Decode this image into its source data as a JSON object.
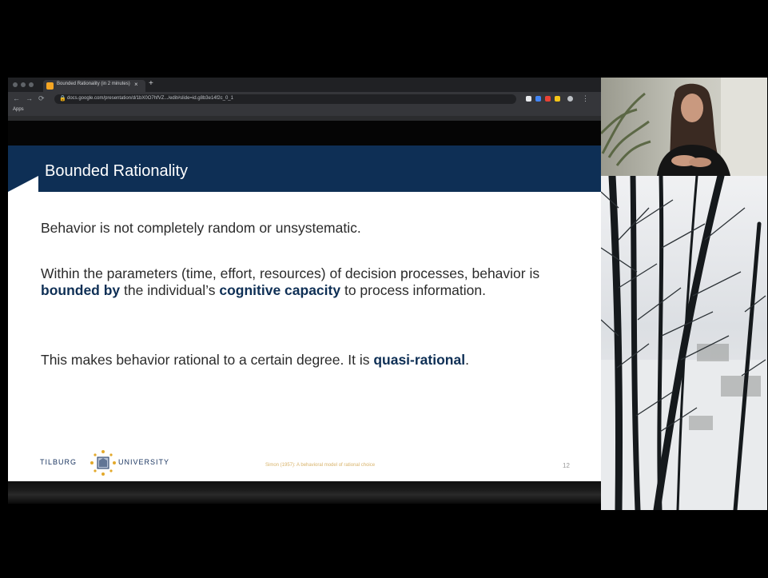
{
  "browser": {
    "tab_title": "Bounded Rationality (in 2 minutes)",
    "tab_close": "×",
    "new_tab": "+",
    "nav": {
      "back": "←",
      "forward": "→",
      "reload": "⟳"
    },
    "url": "docs.google.com/presentation/d/1bX0O7hfVZ.../edit#slide=id.g8b3e14f2c_0_1",
    "bookmarks_label": "Apps"
  },
  "slide": {
    "title": "Bounded Rationality",
    "paragraph1": "Behavior is not completely random or unsystematic.",
    "paragraph2": {
      "part1": "Within the parameters (time, effort, resources) of decision processes, behavior is ",
      "bold1": "bounded by",
      "part2": " the individual’s ",
      "bold2": "cognitive capacity",
      "part3": " to process information."
    },
    "paragraph3": {
      "part1": "This makes behavior rational to a certain degree. It is ",
      "bold1": "quasi-rational",
      "part2": "."
    },
    "footer": {
      "logo_left": "TILBURG",
      "logo_right": "UNIVERSITY",
      "citation": "Simon (1957): A behavioral model of rational choice",
      "page_number": "12"
    }
  },
  "colors": {
    "title_band": "#0e2f55",
    "bold_text": "#0e2f55",
    "citation": "#d8b36a",
    "chrome_dark": "#202124"
  },
  "icons": [
    "lock-icon",
    "star-icon",
    "tilburg-seal-icon",
    "menu-dots-icon"
  ]
}
